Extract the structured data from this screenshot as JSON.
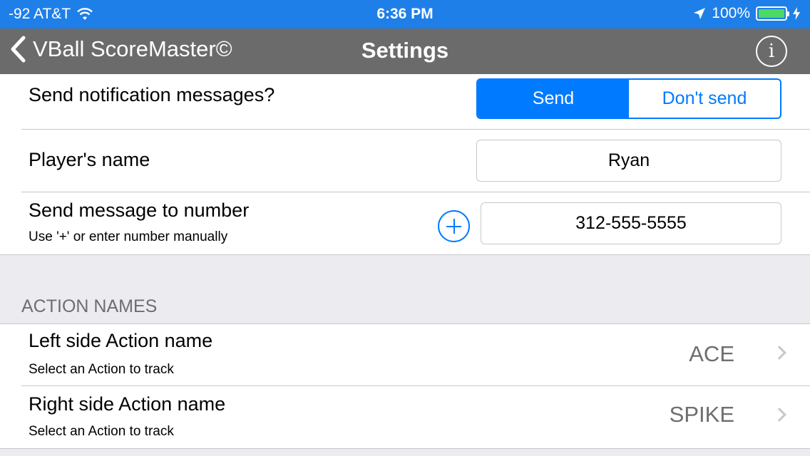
{
  "status_bar": {
    "carrier": "-92 AT&T",
    "time": "6:36 PM",
    "battery": "100%"
  },
  "nav": {
    "back_label": "VBall ScoreMaster©",
    "title": "Settings",
    "info_icon": "i"
  },
  "notifications": {
    "label": "Send notification messages?",
    "options": [
      "Send",
      "Don't send"
    ],
    "selected": "Send"
  },
  "player": {
    "label": "Player's name",
    "value": "Ryan"
  },
  "phone": {
    "label": "Send message to number",
    "hint": "Use '+' or enter number manually",
    "value": "312-555-5555"
  },
  "action_names": {
    "header": "ACTION NAMES",
    "items": [
      {
        "label": "Left side Action name",
        "hint": "Select an Action to track",
        "value": "ACE"
      },
      {
        "label": "Right side Action name",
        "hint": "Select an Action to track",
        "value": "SPIKE"
      }
    ]
  },
  "colors": {
    "status_bar": "#1f7fe8",
    "nav_bar": "#6b6b6b",
    "accent": "#007aff"
  }
}
